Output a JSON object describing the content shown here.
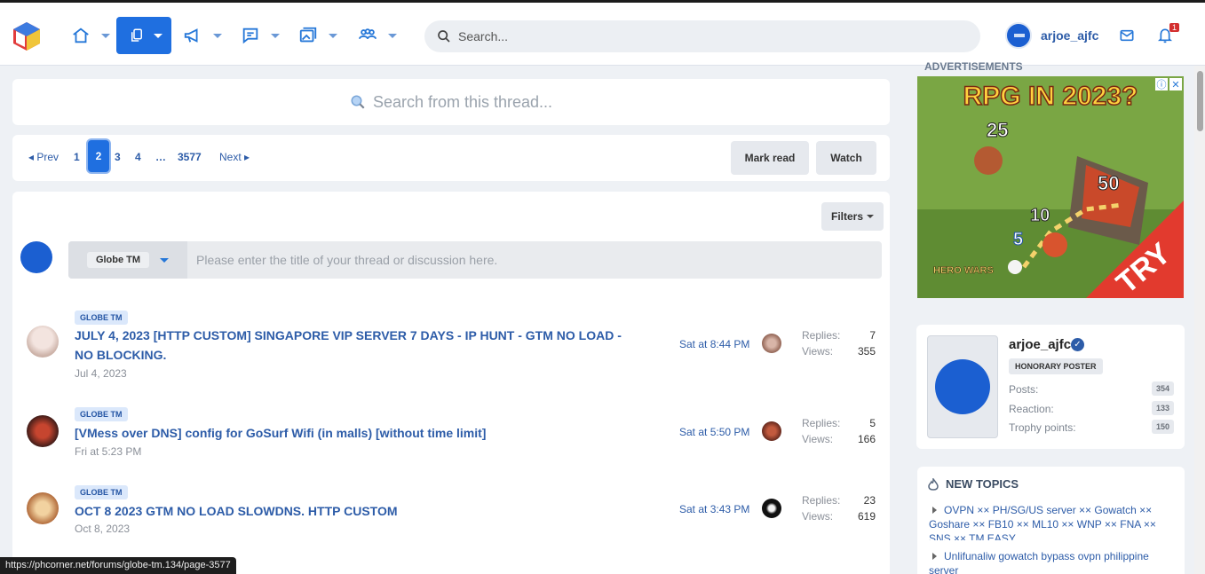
{
  "header": {
    "search_placeholder": "Search...",
    "username": "arjoe_ajfc",
    "notifications": "1"
  },
  "thread_search": {
    "placeholder": "Search from this thread..."
  },
  "pager": {
    "prev": "Prev",
    "pages": [
      "1",
      "3",
      "4",
      "…",
      "3577"
    ],
    "current": "2",
    "next": "Next",
    "mark_read": "Mark read",
    "watch": "Watch"
  },
  "list": {
    "filters": "Filters",
    "new_thread": {
      "prefix": "Globe TM",
      "placeholder": "Please enter the title of your thread or discussion here."
    },
    "threads": [
      {
        "tag": "GLOBE TM",
        "title": "JULY 4, 2023 [HTTP CUSTOM] SINGAPORE VIP SERVER 7 DAYS - IP HUNT - GTM NO LOAD - NO BLOCKING.",
        "date": "Jul 4, 2023",
        "last": "Sat at 8:44 PM",
        "replies_label": "Replies:",
        "replies": "7",
        "views_label": "Views:",
        "views": "355"
      },
      {
        "tag": "GLOBE TM",
        "title": "[VMess over DNS] config for GoSurf Wifi (in malls) [without time limit]",
        "date": "Fri at 5:23 PM",
        "last": "Sat at 5:50 PM",
        "replies_label": "Replies:",
        "replies": "5",
        "views_label": "Views:",
        "views": "166"
      },
      {
        "tag": "GLOBE TM",
        "title": "OCT 8 2023 GTM NO LOAD SLOWDNS. HTTP CUSTOM",
        "date": "Oct 8, 2023",
        "last": "Sat at 3:43 PM",
        "replies_label": "Replies:",
        "replies": "23",
        "views_label": "Views:",
        "views": "619"
      }
    ]
  },
  "sidebar": {
    "ads_label": "ADVERTISEMENTS",
    "ad": {
      "headline": "RPG IN 2023?",
      "n1": "25",
      "n2": "50",
      "n3": "10",
      "n4": "5",
      "brand": "HERO WARS",
      "cta": "TRY"
    },
    "profile": {
      "name": "arjoe_ajfc",
      "role": "HONORARY POSTER",
      "stats": [
        {
          "label": "Posts:",
          "value": "354"
        },
        {
          "label": "Reaction:",
          "value": "133"
        },
        {
          "label": "Trophy points:",
          "value": "150"
        }
      ]
    },
    "new_topics": {
      "title": "NEW TOPICS",
      "items": [
        "OVPN ×× PH/SG/US server ×× Gowatch ×× Goshare ×× FB10 ×× ML10 ×× WNP ×× FNA ×× SNS ×× TM EASY",
        "Unlifunaliw gowatch bypass ovpn philippine server"
      ]
    }
  },
  "status_url": "https://phcorner.net/forums/globe-tm.134/page-3577",
  "colors": {
    "accent": "#1f6fe0",
    "link": "#2d5ca8"
  }
}
